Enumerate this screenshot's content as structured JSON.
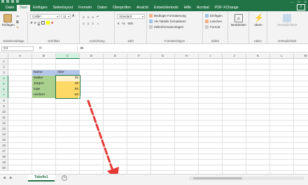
{
  "tabs": [
    "Datei",
    "Start",
    "Einfügen",
    "Seitenlayout",
    "Formeln",
    "Daten",
    "Überprüfen",
    "Ansicht",
    "Entwicklertools",
    "Hilfe",
    "Acrobat",
    "PDF-XChange"
  ],
  "active_tab": "Start",
  "ribbon": {
    "clipboard": {
      "paste": "Einfügen",
      "group": "Zwischenablage"
    },
    "font": {
      "name": "Calibri",
      "size": "11",
      "group": "Schriftart"
    },
    "alignment": {
      "group": "Ausrichtung"
    },
    "number": {
      "format": "Standard",
      "group": "Zahl"
    },
    "styles": {
      "conditional": "Bedingte Formatierung",
      "as_table": "Als Tabelle formatieren",
      "cell_styles": "Zellenformatvorlagen",
      "group": "Formatvorlagen"
    },
    "cells": {
      "insert": "Einfügen",
      "delete": "Löschen",
      "format": "Format",
      "group": "Zellen"
    },
    "editing": {
      "label": "Bearbeiten"
    },
    "ideas": {
      "label": "Ideen",
      "group": "Ideen"
    },
    "sensitivity": {
      "label": "Vertraulichkeit",
      "group": "Vertraulichkeit"
    }
  },
  "formula_bar": {
    "name_box": "C4",
    "fx": "fx",
    "value": "35"
  },
  "columns": [
    "A",
    "B",
    "C",
    "D",
    "E",
    "F",
    "G",
    "H",
    "I",
    "J",
    "K",
    "L",
    "M"
  ],
  "rows": [
    "1",
    "2",
    "3",
    "4",
    "5",
    "6",
    "7",
    "8",
    "9",
    "10",
    "11",
    "12",
    "13",
    "14",
    "15",
    "16",
    "17",
    "18",
    "19",
    "20"
  ],
  "table": {
    "headers": [
      "Name",
      "Alter"
    ],
    "names": [
      "Walter",
      "Jürgen",
      "Inge",
      "Herbert"
    ],
    "ages": [
      "35",
      "48",
      "56",
      "68"
    ]
  },
  "sheet_tab": "Tabelle1",
  "colors": {
    "excel_green": "#217346",
    "header_blue": "#b4c6e7",
    "name_green": "#a9d08e",
    "age_orange": "#ffd966",
    "arrow_red": "#e53935"
  }
}
